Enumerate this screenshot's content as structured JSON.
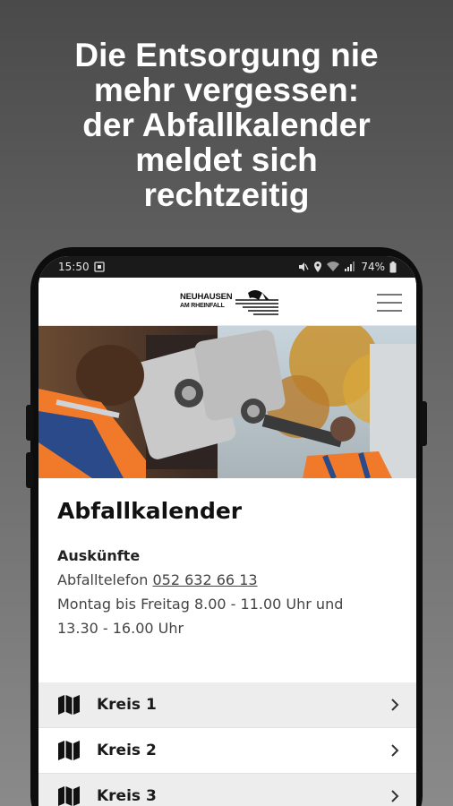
{
  "promo": {
    "line1": "Die Entsorgung nie",
    "line2": "mehr vergessen:",
    "line3": "der Abfallkalender",
    "line4": "meldet sich",
    "line5": "rechtzeitig"
  },
  "statusbar": {
    "time": "15:50",
    "battery": "74%"
  },
  "appbar": {
    "logo_line1": "NEUHAUSEN",
    "logo_line2": "AM RHEINFALL"
  },
  "page": {
    "title": "Abfallkalender",
    "section_title": "Auskünfte",
    "phone_label": "Abfalltelefon",
    "phone_number": "052 632 66 13",
    "hours_line1": "Montag bis Freitag 8.00 - 11.00 Uhr und",
    "hours_line2": "13.30 - 16.00 Uhr"
  },
  "list": {
    "items": [
      {
        "label": "Kreis 1",
        "icon": "map-icon"
      },
      {
        "label": "Kreis 2",
        "icon": "map-icon"
      },
      {
        "label": "Kreis 3",
        "icon": "map-icon"
      }
    ]
  },
  "colors": {
    "background_top": "#4a4a4a",
    "background_bottom": "#8a8a8a",
    "list_row_alt": "#ededed",
    "worker_vest": "#f07a2a"
  }
}
